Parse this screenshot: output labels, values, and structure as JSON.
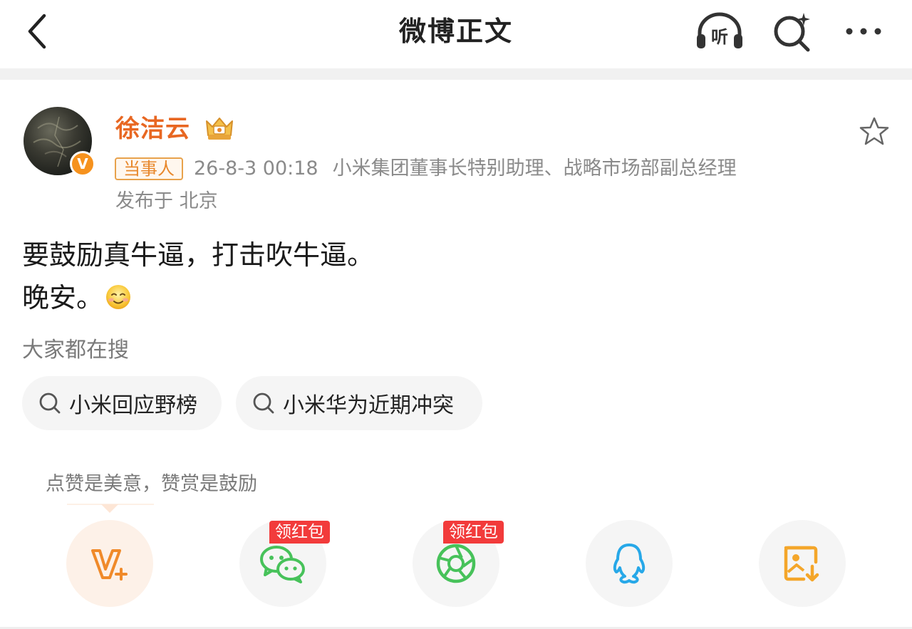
{
  "header": {
    "title": "微博正文",
    "listen_label": "听"
  },
  "post": {
    "author": {
      "name": "徐洁云",
      "verified_badge": "V"
    },
    "tag": "当事人",
    "time": "26-8-3 00:18",
    "author_title": "小米集团董事长特别助理、战略市场部副总经理",
    "location": "发布于 北京",
    "content_lines": [
      "要鼓励真牛逼，打击吹牛逼。",
      "晚安。"
    ]
  },
  "hot_search": {
    "title": "大家都在搜",
    "items": [
      {
        "label": "小米回应野榜"
      },
      {
        "label": "小米华为近期冲突"
      }
    ]
  },
  "reward": {
    "tip": "点赞是美意，赞赏是鼓励"
  },
  "share": {
    "red_packet_label": "领红包",
    "items": [
      {
        "icon": "reward-v-icon"
      },
      {
        "icon": "wechat-icon",
        "tag": "领红包"
      },
      {
        "icon": "moments-icon",
        "tag": "领红包"
      },
      {
        "icon": "qq-icon"
      },
      {
        "icon": "save-image-icon"
      }
    ]
  },
  "colors": {
    "accent_orange": "#e86722",
    "red_tag": "#f23b3b",
    "wechat_green": "#47c25a",
    "qq_blue": "#27a8e8",
    "save_orange": "#f4a62a"
  }
}
